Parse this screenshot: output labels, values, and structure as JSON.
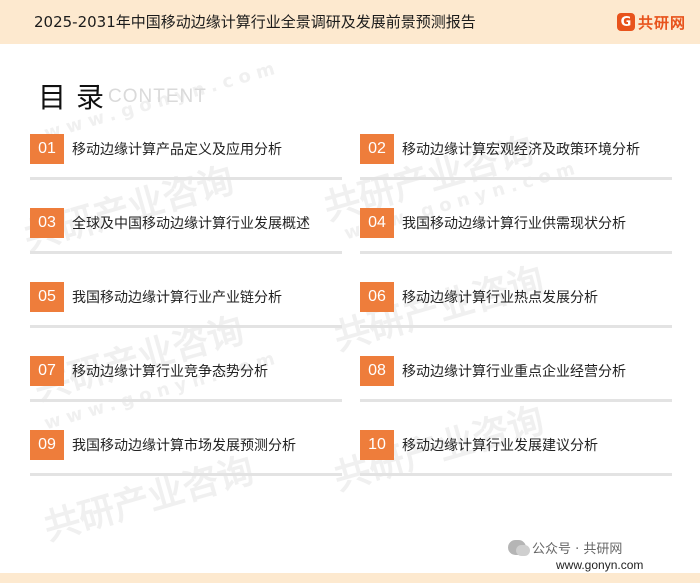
{
  "header": {
    "title": "2025-2031年中国移动边缘计算行业全景调研及发展前景预测报告",
    "logo_mark": "G",
    "logo_text": "共研网"
  },
  "watermark": {
    "cn": "共研产业咨询",
    "url": "www.gonyn.com"
  },
  "toc": {
    "heading": "目录",
    "subheading": "CONTENT",
    "items": [
      {
        "num": "01",
        "label": "移动边缘计算产品定义及应用分析"
      },
      {
        "num": "02",
        "label": "移动边缘计算宏观经济及政策环境分析"
      },
      {
        "num": "03",
        "label": "全球及中国移动边缘计算行业发展概述"
      },
      {
        "num": "04",
        "label": "我国移动边缘计算行业供需现状分析"
      },
      {
        "num": "05",
        "label": "我国移动边缘计算行业产业链分析"
      },
      {
        "num": "06",
        "label": "移动边缘计算行业热点发展分析"
      },
      {
        "num": "07",
        "label": "移动边缘计算行业竞争态势分析"
      },
      {
        "num": "08",
        "label": "移动边缘计算行业重点企业经营分析"
      },
      {
        "num": "09",
        "label": "我国移动边缘计算市场发展预测分析"
      },
      {
        "num": "10",
        "label": "移动边缘计算行业发展建议分析"
      }
    ]
  },
  "footer": {
    "wechat": "公众号 · 共研网",
    "site": "www.gonyn.com"
  },
  "colors": {
    "accent": "#ee7d3b",
    "header_bg": "#fde9cf",
    "logo": "#e8531c"
  }
}
